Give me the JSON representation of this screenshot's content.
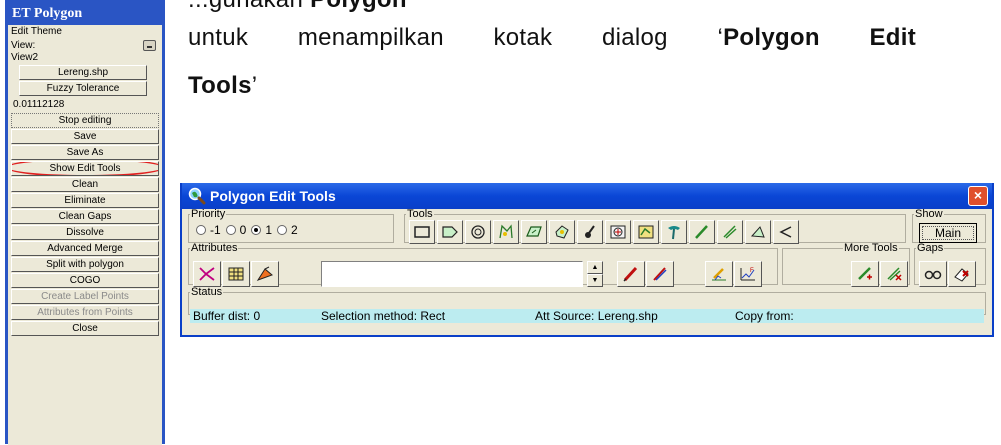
{
  "et_panel": {
    "title": "ET Polygon",
    "edit_theme_label": "Edit Theme",
    "view_label": "View:",
    "view_value": "View2",
    "theme_button": "Lereng.shp",
    "fuzzy_button": "Fuzzy Tolerance",
    "tolerance_value": "0.01112128",
    "buttons": [
      {
        "label": "Stop editing",
        "state": "dotted"
      },
      {
        "label": "Save",
        "state": "normal"
      },
      {
        "label": "Save As",
        "state": "normal"
      },
      {
        "label": "Show Edit Tools",
        "state": "highlighted"
      },
      {
        "label": "Clean",
        "state": "normal"
      },
      {
        "label": "Eliminate",
        "state": "normal"
      },
      {
        "label": "Clean Gaps",
        "state": "normal"
      },
      {
        "label": "Dissolve",
        "state": "normal"
      },
      {
        "label": "Advanced Merge",
        "state": "normal"
      },
      {
        "label": "Split with polygon",
        "state": "normal"
      },
      {
        "label": "COGO",
        "state": "normal"
      },
      {
        "label": "Create Label Points",
        "state": "disabled"
      },
      {
        "label": "Attributes from Points",
        "state": "disabled"
      },
      {
        "label": "Close",
        "state": "normal"
      }
    ]
  },
  "text": {
    "line1_before": "...gunakan ",
    "line1_bold": "Polygon",
    "line2_w1": "untuk",
    "line2_w2": "menampilkan",
    "line2_w3": "kotak",
    "line2_w4": "dialog",
    "line2_quote": "‘",
    "line2_b1": "Polygon",
    "line2_b2": "Edit",
    "line3_bold": "Tools",
    "line3_quote": "’"
  },
  "dialog": {
    "title": "Polygon Edit Tools",
    "close_label": "×",
    "priority": {
      "legend": "Priority",
      "options": [
        "-1",
        "0",
        "1",
        "2"
      ],
      "selected": "1"
    },
    "tools_legend": "Tools",
    "show": {
      "legend": "Show",
      "main_label": "Main"
    },
    "attributes_legend": "Attributes",
    "attributes_input": "",
    "more_tools_legend": "More Tools",
    "gaps_legend": "Gaps",
    "status": {
      "legend": "Status",
      "buffer": "Buffer dist: 0",
      "selection": "Selection method: Rect",
      "source": "Att Source: Lereng.shp",
      "copy": "Copy from:"
    }
  },
  "colors": {
    "panel_blue": "#2a55c4",
    "title_blue": "#0a46d6",
    "close_red": "#e04f2c",
    "highlight_ring": "#e02020",
    "status_bg": "#bcecf0"
  }
}
